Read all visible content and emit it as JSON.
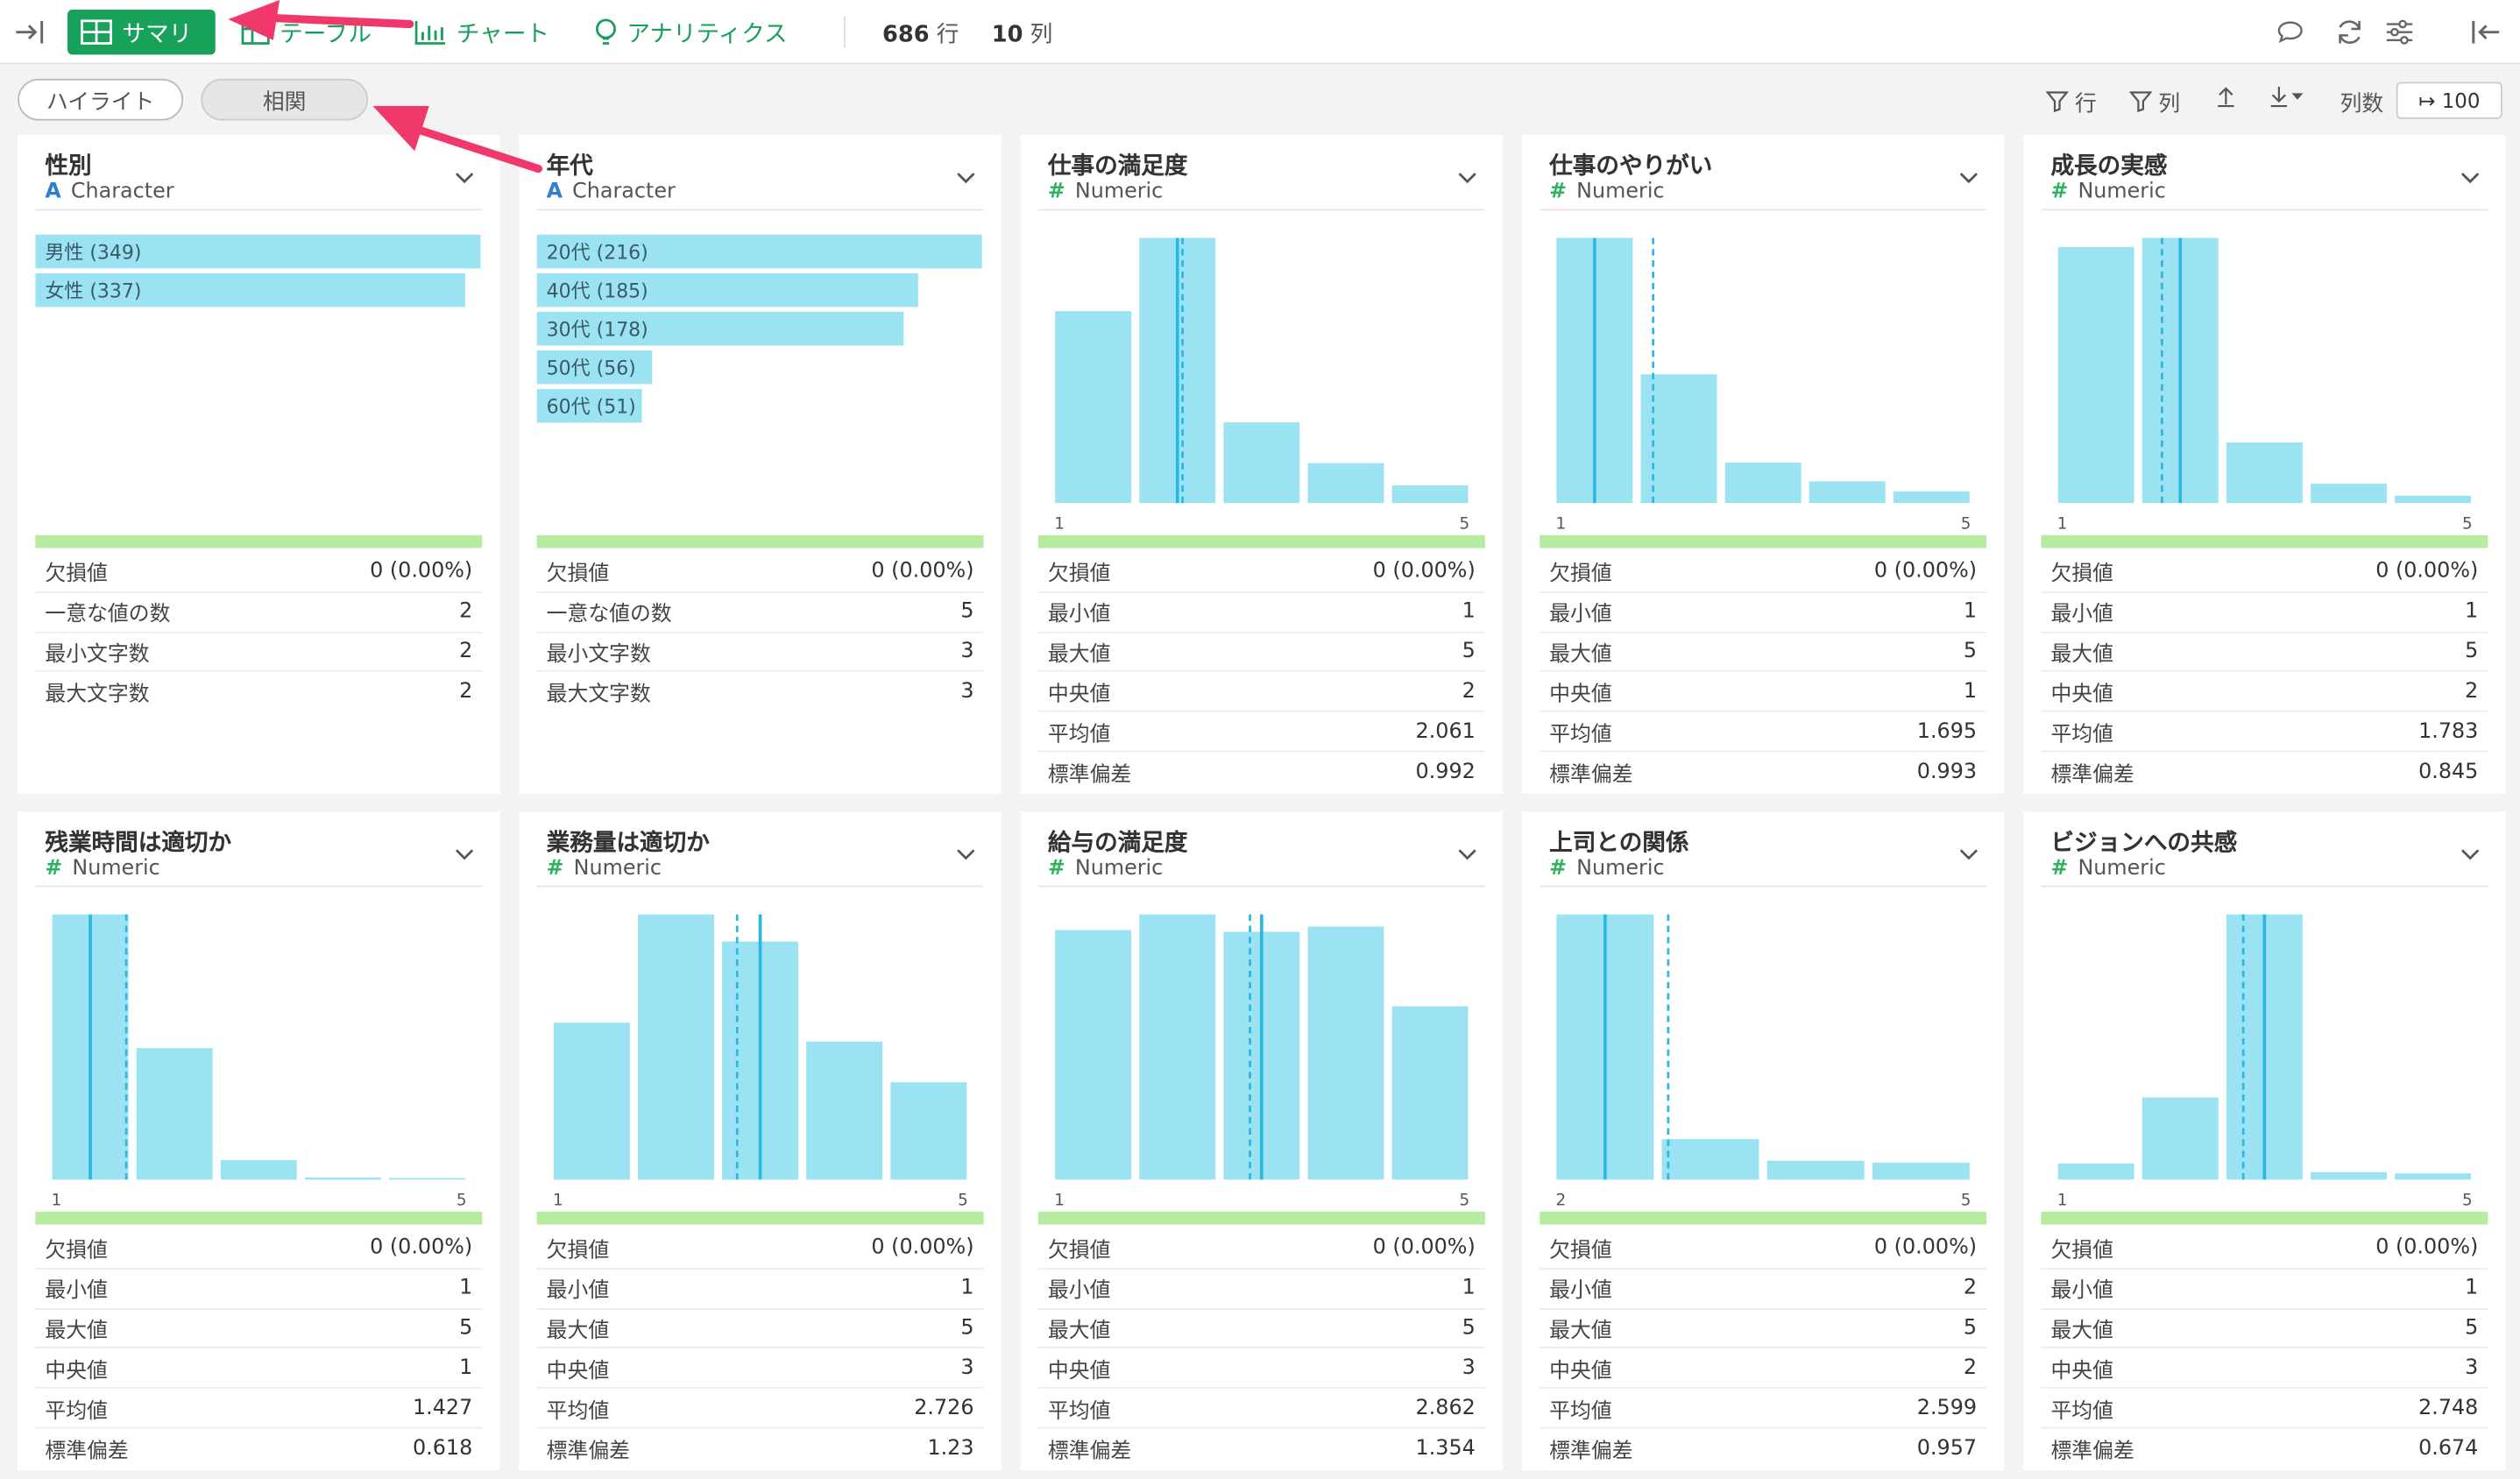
{
  "header": {
    "tabs": [
      {
        "label": "サマリ",
        "active": true
      },
      {
        "label": "テーブル",
        "active": false
      },
      {
        "label": "チャート",
        "active": false
      },
      {
        "label": "アナリティクス",
        "active": false
      }
    ],
    "rows": {
      "value": "686",
      "unit": "行"
    },
    "cols": {
      "value": "10",
      "unit": "列"
    }
  },
  "toolbar": {
    "highlight": "ハイライト",
    "correlation": "相関",
    "filter_rows": "行",
    "filter_cols": "列",
    "cols_label": "列数",
    "cols_value": "100"
  },
  "colors": {
    "bar": "#9be3f3",
    "accent": "#17a15a",
    "line": "#2bb8e0",
    "annotation_arrow": "#f0386b"
  },
  "cards": [
    {
      "title": "性別",
      "type": "Character",
      "type_icon": "A",
      "kind": "char",
      "chart_data": {
        "type": "bar",
        "categories": [
          "男性",
          "女性"
        ],
        "values": [
          349,
          337
        ],
        "labels": [
          "男性 (349)",
          "女性 (337)"
        ]
      },
      "stats": [
        {
          "label": "欠損値",
          "value": "0 (0.00%)"
        },
        {
          "label": "一意な値の数",
          "value": "2"
        },
        {
          "label": "最小文字数",
          "value": "2"
        },
        {
          "label": "最大文字数",
          "value": "2"
        }
      ]
    },
    {
      "title": "年代",
      "type": "Character",
      "type_icon": "A",
      "kind": "char",
      "chart_data": {
        "type": "bar",
        "categories": [
          "20代",
          "40代",
          "30代",
          "50代",
          "60代"
        ],
        "values": [
          216,
          185,
          178,
          56,
          51
        ],
        "labels": [
          "20代 (216)",
          "40代 (185)",
          "30代 (178)",
          "50代 (56)",
          "60代 (51)"
        ]
      },
      "stats": [
        {
          "label": "欠損値",
          "value": "0 (0.00%)"
        },
        {
          "label": "一意な値の数",
          "value": "5"
        },
        {
          "label": "最小文字数",
          "value": "3"
        },
        {
          "label": "最大文字数",
          "value": "3"
        }
      ]
    },
    {
      "title": "仕事の満足度",
      "type": "Numeric",
      "type_icon": "#",
      "kind": "num",
      "chart_data": {
        "type": "bar",
        "bins": [
          1,
          2,
          3,
          4,
          5
        ],
        "values": [
          207,
          286,
          87,
          43,
          19
        ],
        "x_min": "1",
        "x_max": "5",
        "median": 2,
        "mean": 2.061
      },
      "stats": [
        {
          "label": "欠損値",
          "value": "0 (0.00%)"
        },
        {
          "label": "最小値",
          "value": "1"
        },
        {
          "label": "最大値",
          "value": "5"
        },
        {
          "label": "中央値",
          "value": "2"
        },
        {
          "label": "平均値",
          "value": "2.061"
        },
        {
          "label": "標準偏差",
          "value": "0.992"
        }
      ]
    },
    {
      "title": "仕事のやりがい",
      "type": "Numeric",
      "type_icon": "#",
      "kind": "num",
      "chart_data": {
        "type": "bar",
        "bins": [
          1,
          2,
          3,
          4,
          5
        ],
        "values": [
          342,
          166,
          52,
          28,
          15
        ],
        "x_min": "1",
        "x_max": "5",
        "median": 1,
        "mean": 1.695
      },
      "stats": [
        {
          "label": "欠損値",
          "value": "0 (0.00%)"
        },
        {
          "label": "最小値",
          "value": "1"
        },
        {
          "label": "最大値",
          "value": "5"
        },
        {
          "label": "中央値",
          "value": "1"
        },
        {
          "label": "平均値",
          "value": "1.695"
        },
        {
          "label": "標準偏差",
          "value": "0.993"
        }
      ]
    },
    {
      "title": "成長の実感",
      "type": "Numeric",
      "type_icon": "#",
      "kind": "num",
      "chart_data": {
        "type": "bar",
        "bins": [
          1,
          2,
          3,
          4,
          5
        ],
        "values": [
          279,
          289,
          66,
          21,
          8
        ],
        "x_min": "1",
        "x_max": "5",
        "median": 2,
        "mean": 1.783
      },
      "stats": [
        {
          "label": "欠損値",
          "value": "0 (0.00%)"
        },
        {
          "label": "最小値",
          "value": "1"
        },
        {
          "label": "最大値",
          "value": "5"
        },
        {
          "label": "中央値",
          "value": "2"
        },
        {
          "label": "平均値",
          "value": "1.783"
        },
        {
          "label": "標準偏差",
          "value": "0.845"
        }
      ]
    },
    {
      "title": "残業時間は適切か",
      "type": "Numeric",
      "type_icon": "#",
      "kind": "num",
      "chart_data": {
        "type": "bar",
        "bins": [
          1,
          2,
          3,
          4,
          5
        ],
        "values": [
          488,
          242,
          36,
          4,
          3
        ],
        "x_min": "1",
        "x_max": "5",
        "median": 1,
        "mean": 1.427
      },
      "stats": [
        {
          "label": "欠損値",
          "value": "0 (0.00%)"
        },
        {
          "label": "最小値",
          "value": "1"
        },
        {
          "label": "最大値",
          "value": "5"
        },
        {
          "label": "中央値",
          "value": "1"
        },
        {
          "label": "平均値",
          "value": "1.427"
        },
        {
          "label": "標準偏差",
          "value": "0.618"
        }
      ]
    },
    {
      "title": "業務量は適切か",
      "type": "Numeric",
      "type_icon": "#",
      "kind": "num",
      "chart_data": {
        "type": "bar",
        "bins": [
          1,
          2,
          3,
          4,
          5
        ],
        "values": [
          58,
          98,
          88,
          51,
          36
        ],
        "x_min": "1",
        "x_max": "5",
        "median": 3,
        "mean": 2.726
      },
      "stats": [
        {
          "label": "欠損値",
          "value": "0 (0.00%)"
        },
        {
          "label": "最小値",
          "value": "1"
        },
        {
          "label": "最大値",
          "value": "5"
        },
        {
          "label": "中央値",
          "value": "3"
        },
        {
          "label": "平均値",
          "value": "2.726"
        },
        {
          "label": "標準偏差",
          "value": "1.23"
        }
      ]
    },
    {
      "title": "給与の満足度",
      "type": "Numeric",
      "type_icon": "#",
      "kind": "num",
      "chart_data": {
        "type": "bar",
        "bins": [
          1,
          2,
          3,
          4,
          5
        ],
        "values": [
          144,
          153,
          143,
          146,
          100
        ],
        "x_min": "1",
        "x_max": "5",
        "median": 3,
        "mean": 2.862
      },
      "stats": [
        {
          "label": "欠損値",
          "value": "0 (0.00%)"
        },
        {
          "label": "最小値",
          "value": "1"
        },
        {
          "label": "最大値",
          "value": "5"
        },
        {
          "label": "中央値",
          "value": "3"
        },
        {
          "label": "平均値",
          "value": "2.862"
        },
        {
          "label": "標準偏差",
          "value": "1.354"
        }
      ]
    },
    {
      "title": "上司との関係",
      "type": "Numeric",
      "type_icon": "#",
      "kind": "num",
      "chart_data": {
        "type": "bar",
        "bins": [
          2,
          3,
          4,
          5
        ],
        "values": [
          406,
          62,
          29,
          26
        ],
        "x_min": "2",
        "x_max": "5",
        "median": 2,
        "mean": 2.599
      },
      "stats": [
        {
          "label": "欠損値",
          "value": "0 (0.00%)"
        },
        {
          "label": "最小値",
          "value": "2"
        },
        {
          "label": "最大値",
          "value": "5"
        },
        {
          "label": "中央値",
          "value": "2"
        },
        {
          "label": "平均値",
          "value": "2.599"
        },
        {
          "label": "標準偏差",
          "value": "0.957"
        }
      ]
    },
    {
      "title": "ビジョンへの共感",
      "type": "Numeric",
      "type_icon": "#",
      "kind": "num",
      "chart_data": {
        "type": "bar",
        "bins": [
          1,
          2,
          3,
          4,
          5
        ],
        "values": [
          26,
          132,
          426,
          12,
          10
        ],
        "x_min": "1",
        "x_max": "5",
        "median": 3,
        "mean": 2.748
      },
      "stats": [
        {
          "label": "欠損値",
          "value": "0 (0.00%)"
        },
        {
          "label": "最小値",
          "value": "1"
        },
        {
          "label": "最大値",
          "value": "5"
        },
        {
          "label": "中央値",
          "value": "3"
        },
        {
          "label": "平均値",
          "value": "2.748"
        },
        {
          "label": "標準偏差",
          "value": "0.674"
        }
      ]
    }
  ]
}
